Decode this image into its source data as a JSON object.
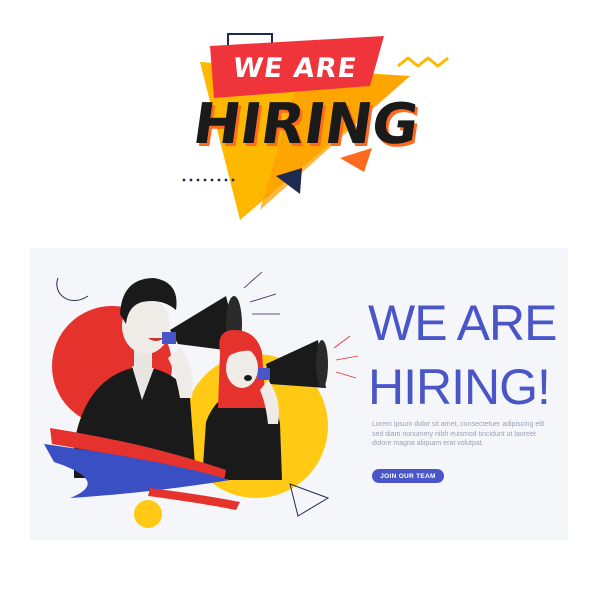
{
  "logo": {
    "line1": "WE ARE",
    "line2": "HIRING"
  },
  "banner": {
    "headline_line1": "WE ARE",
    "headline_line2": "HIRING!",
    "body_text": "Lorem ipsum dolor sit amet, consectetuer adipiscing elit sed diam nonummy nibh euismod tincidunt ut laoreet dolore magna aliquam erat volutpat.",
    "button_label": "JOIN OUR TEAM"
  },
  "colors": {
    "logo_yellow": "#ffb800",
    "logo_red": "#f0343c",
    "logo_orange": "#ff6a1e",
    "logo_dark": "#1a1a1a",
    "banner_blue": "#4a55c8",
    "banner_red": "#e5322d",
    "banner_yellow": "#ffc914",
    "banner_bg": "#f4f6fa"
  },
  "icons": [
    "megaphone-icon",
    "megaphone-icon"
  ]
}
